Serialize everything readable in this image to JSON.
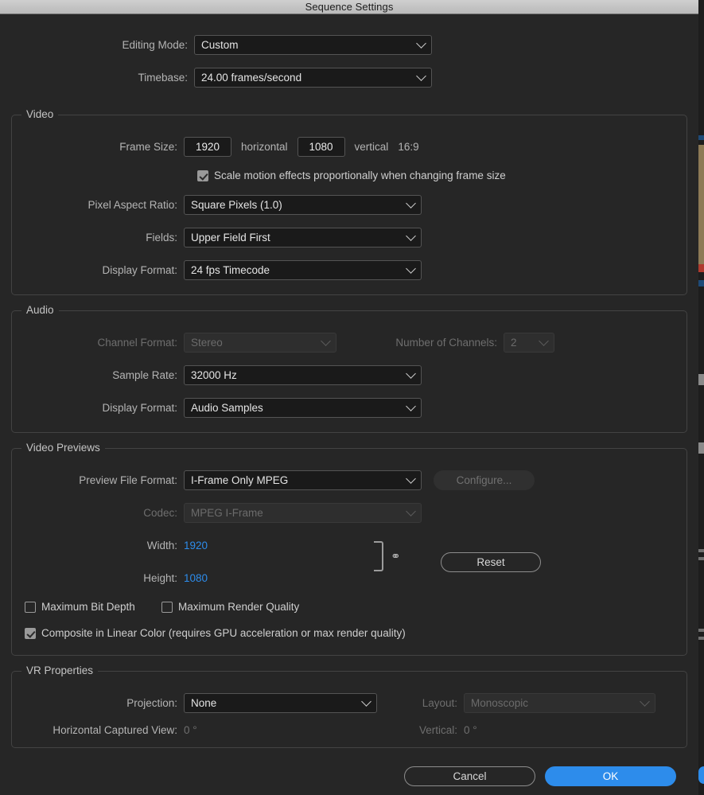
{
  "window": {
    "title": "Sequence Settings"
  },
  "top": {
    "editing_mode": {
      "label": "Editing Mode:",
      "value": "Custom"
    },
    "timebase": {
      "label": "Timebase:",
      "value": "24.00  frames/second"
    }
  },
  "video": {
    "legend": "Video",
    "frame_size": {
      "label": "Frame Size:",
      "horizontal_value": "1920",
      "horizontal_label": "horizontal",
      "vertical_value": "1080",
      "vertical_label": "vertical",
      "aspect": "16:9"
    },
    "scale_motion": {
      "label": "Scale motion effects proportionally when changing frame size",
      "checked": true
    },
    "pixel_aspect_ratio": {
      "label": "Pixel Aspect Ratio:",
      "value": "Square Pixels (1.0)"
    },
    "fields": {
      "label": "Fields:",
      "value": "Upper Field First"
    },
    "display_format": {
      "label": "Display Format:",
      "value": "24 fps Timecode"
    }
  },
  "audio": {
    "legend": "Audio",
    "channel_format": {
      "label": "Channel Format:",
      "value": "Stereo",
      "disabled": true
    },
    "number_of_channels": {
      "label": "Number of Channels:",
      "value": "2",
      "disabled": true
    },
    "sample_rate": {
      "label": "Sample Rate:",
      "value": "32000 Hz"
    },
    "display_format": {
      "label": "Display Format:",
      "value": "Audio Samples"
    }
  },
  "video_previews": {
    "legend": "Video Previews",
    "preview_file_format": {
      "label": "Preview File Format:",
      "value": "I-Frame Only MPEG"
    },
    "configure_button": "Configure...",
    "codec": {
      "label": "Codec:",
      "value": "MPEG I-Frame",
      "disabled": true
    },
    "width": {
      "label": "Width:",
      "value": "1920"
    },
    "height": {
      "label": "Height:",
      "value": "1080"
    },
    "link_icon": "chain-link-icon",
    "reset_button": "Reset",
    "maximum_bit_depth": {
      "label": "Maximum Bit Depth",
      "checked": false
    },
    "maximum_render_quality": {
      "label": "Maximum Render Quality",
      "checked": false
    },
    "composite_linear_color": {
      "label": "Composite in Linear Color (requires GPU acceleration or max render quality)",
      "checked": true
    }
  },
  "vr_properties": {
    "legend": "VR Properties",
    "projection": {
      "label": "Projection:",
      "value": "None"
    },
    "layout": {
      "label": "Layout:",
      "value": "Monoscopic",
      "disabled": true
    },
    "horizontal_captured_view": {
      "label": "Horizontal Captured View:",
      "value": "0 °"
    },
    "vertical": {
      "label": "Vertical:",
      "value": "0 °"
    }
  },
  "footer": {
    "cancel": "Cancel",
    "ok": "OK"
  },
  "colors": {
    "accent": "#2d8ceb",
    "hot_text": "#2d8ceb",
    "dialog_bg": "#262626",
    "titlebar": "#c4c4c4"
  }
}
